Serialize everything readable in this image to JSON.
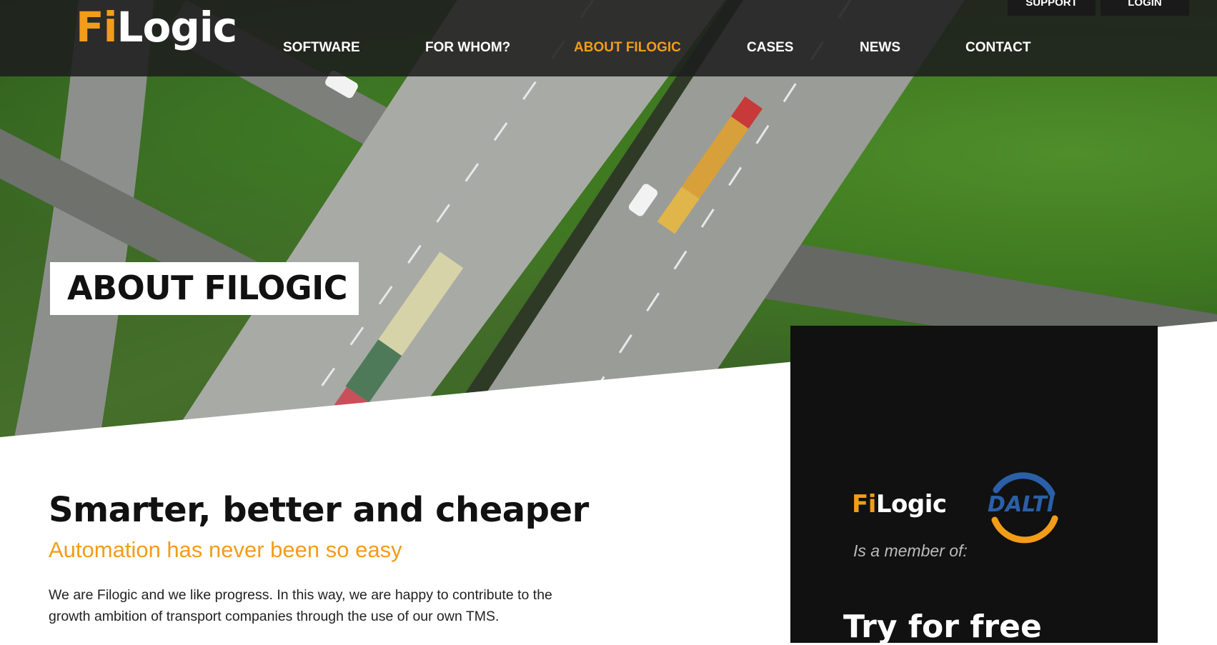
{
  "header": {
    "logo_fi": "Fi",
    "logo_logic": "Logic",
    "top_buttons": [
      "SUPPORT",
      "LOGIN"
    ],
    "nav": [
      "SOFTWARE",
      "FOR WHOM?",
      "ABOUT FILOGIC",
      "CASES",
      "NEWS",
      "CONTACT"
    ],
    "active_nav": "ABOUT FILOGIC"
  },
  "hero": {
    "title": "ABOUT FILOGIC"
  },
  "main": {
    "headline": "Smarter, better and cheaper",
    "subheadline": "Automation has never been so easy",
    "paragraph": "We are Filogic and we like progress. In this way, we are happy to contribute to the growth ambition of transport companies through the use of our own TMS."
  },
  "side_panel": {
    "logo_fi": "Fi",
    "logo_logic": "Logic",
    "partner_logo_text": "DALTI",
    "member_text": "Is a member of:",
    "cta_heading": "Try for free"
  },
  "colors": {
    "accent": "#f39c19",
    "nav_bg": "#1e1e1e",
    "panel_bg": "#111111",
    "dalti_blue": "#2b5fa8"
  }
}
